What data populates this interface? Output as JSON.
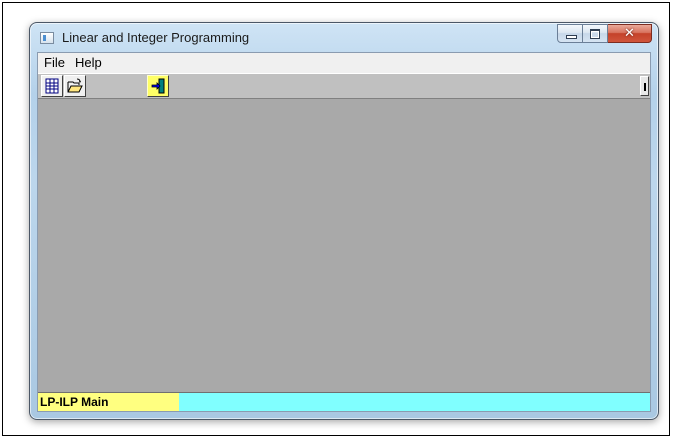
{
  "window": {
    "title": "Linear and Integer Programming",
    "close_glyph": "✕"
  },
  "menu": {
    "items": [
      "File",
      "Help"
    ]
  },
  "toolbar": {
    "buttons": [
      {
        "name": "new-table-button",
        "icon": "table-grid-icon"
      },
      {
        "name": "open-folder-button",
        "icon": "open-folder-icon"
      },
      {
        "name": "exit-button",
        "icon": "exit-door-icon"
      }
    ]
  },
  "status": {
    "left_text": "LP-ILP Main"
  },
  "colors": {
    "workspace": "#a9a9a9",
    "status_left": "#ffff80",
    "status_right": "#80ffff",
    "toolbar": "#c0c0c0"
  }
}
